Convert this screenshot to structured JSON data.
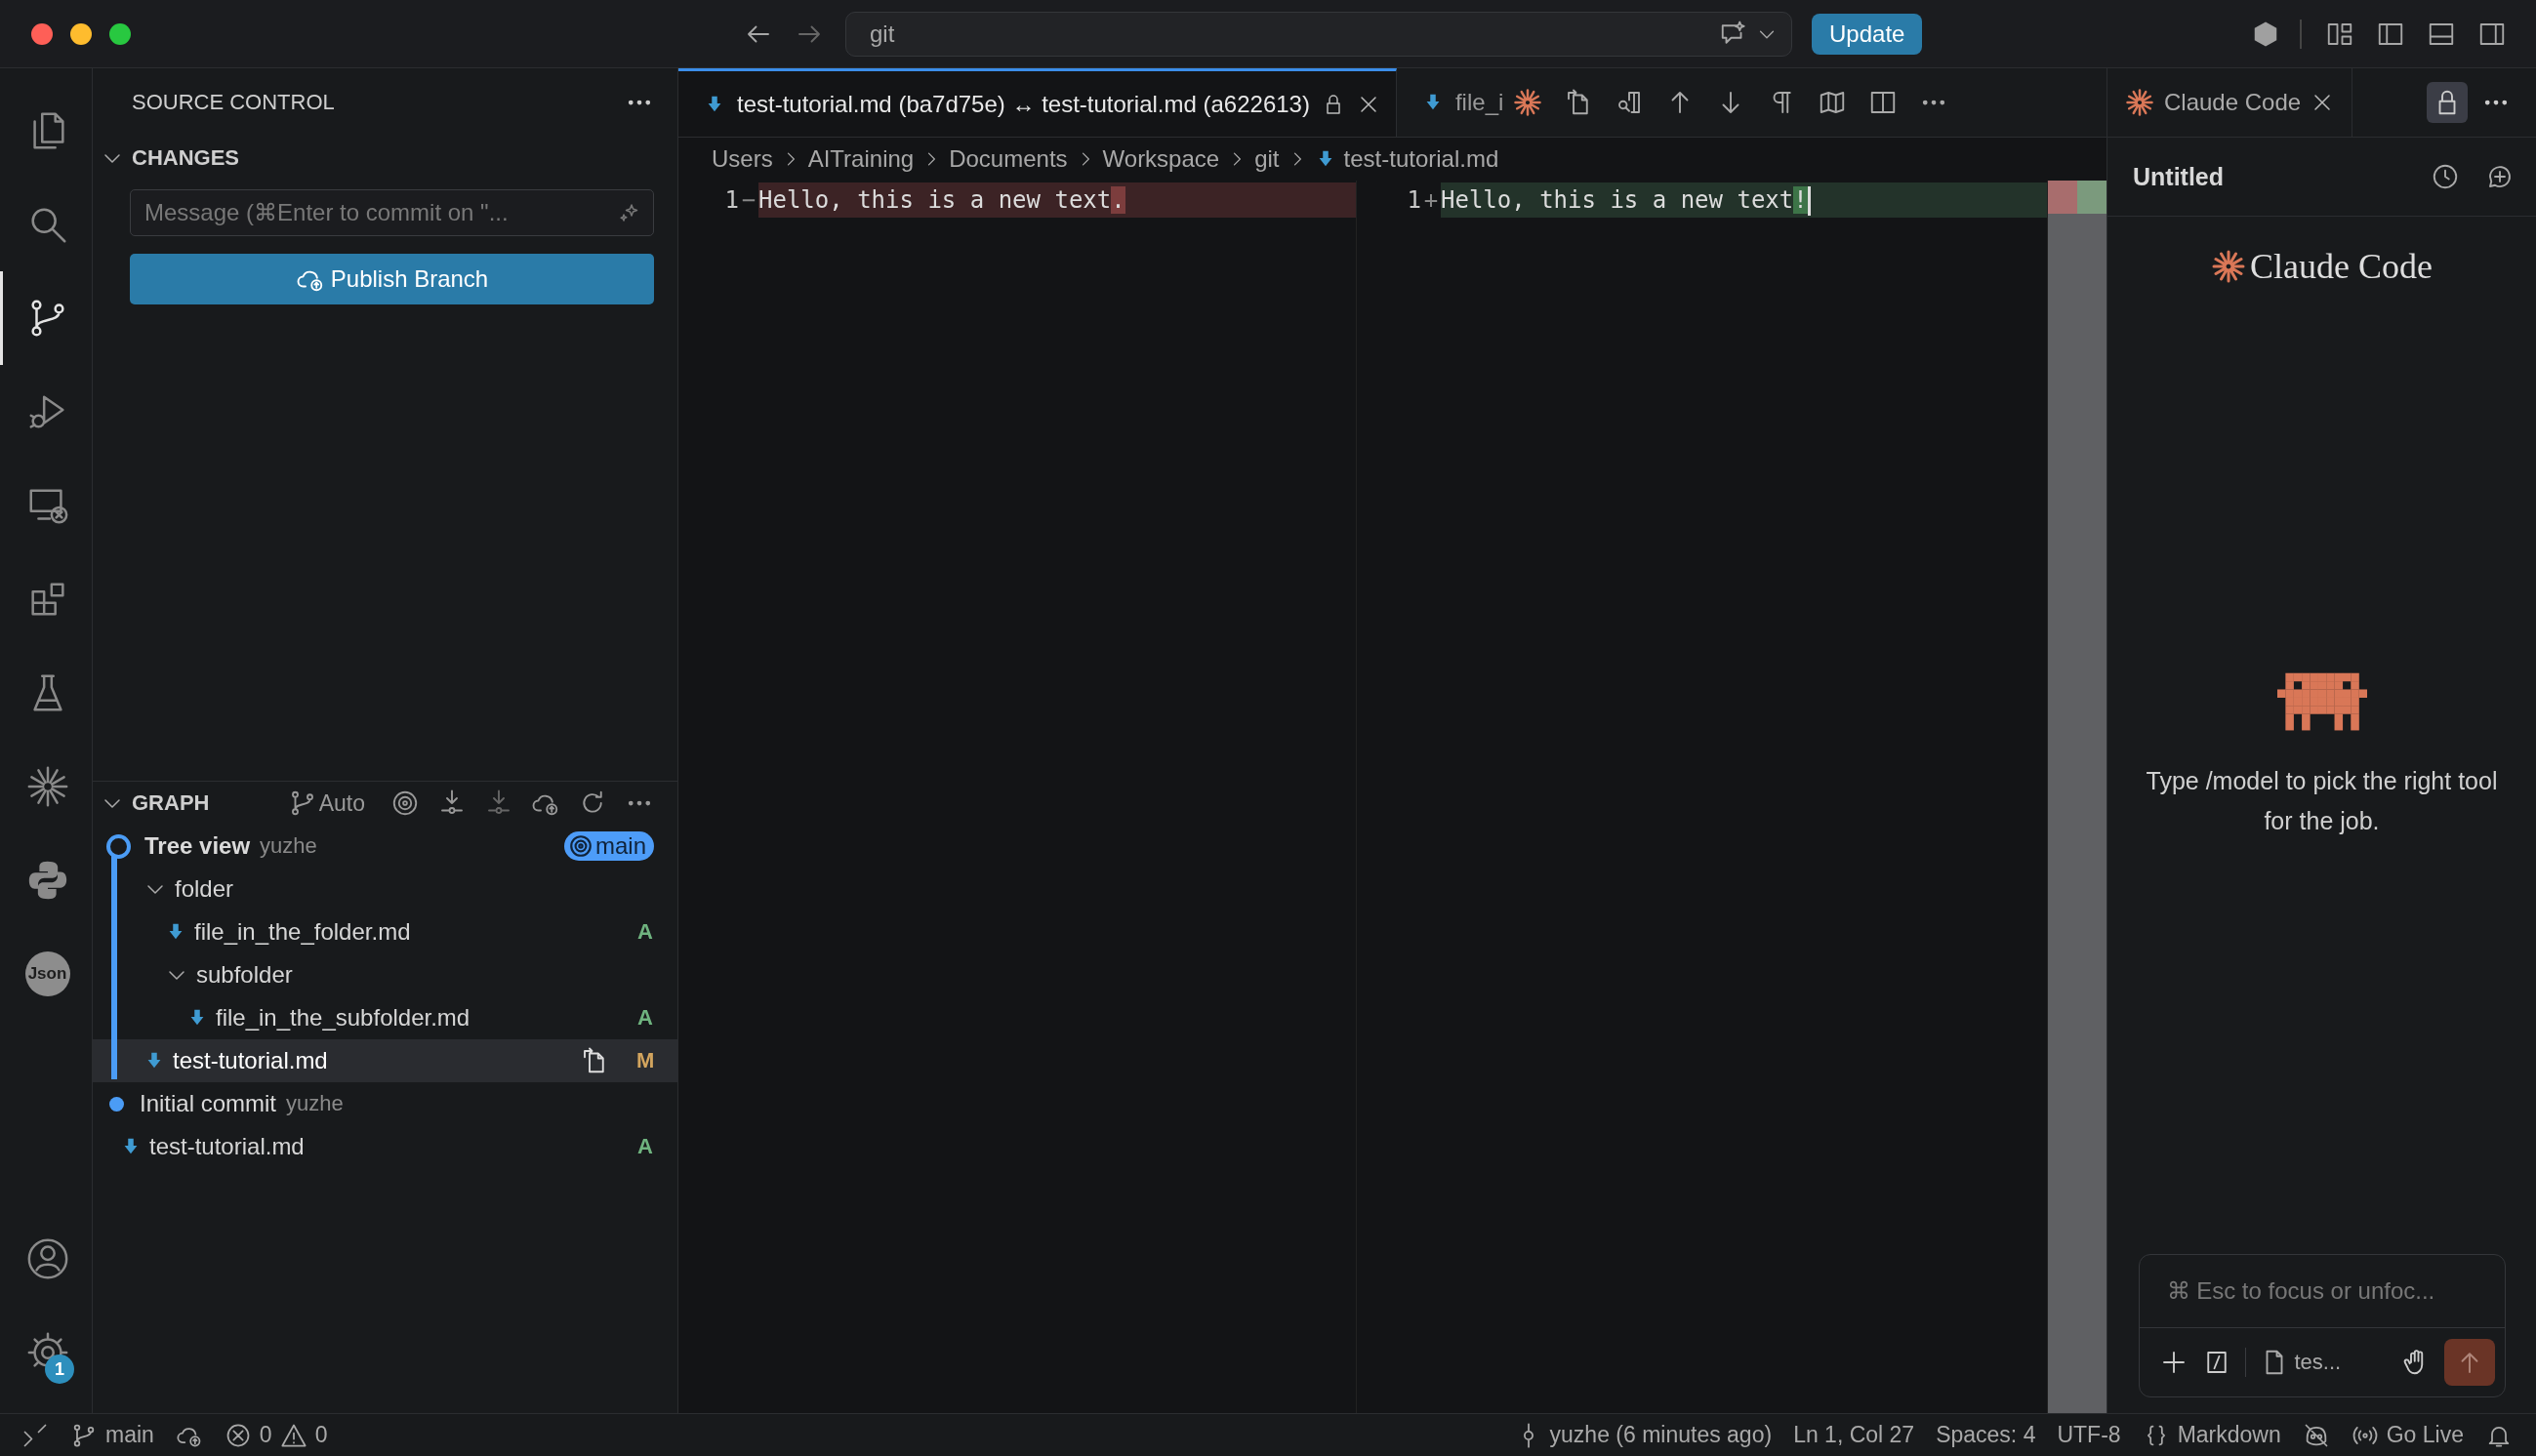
{
  "title_bar": {
    "search": "git",
    "update_button": "Update"
  },
  "activity_bar": {
    "items": [
      {
        "kind": "explorer",
        "selected": false
      },
      {
        "kind": "search",
        "selected": false
      },
      {
        "kind": "source-control",
        "selected": true
      },
      {
        "kind": "run-debug",
        "selected": false
      },
      {
        "kind": "remote",
        "selected": false
      },
      {
        "kind": "extensions",
        "selected": false
      },
      {
        "kind": "testing",
        "selected": false
      },
      {
        "kind": "claude",
        "selected": false
      },
      {
        "kind": "python",
        "selected": false
      },
      {
        "kind": "json",
        "label": "Json",
        "selected": false
      }
    ],
    "bottom": [
      {
        "kind": "account"
      },
      {
        "kind": "settings",
        "badge": "1"
      }
    ]
  },
  "sidebar": {
    "title": "SOURCE CONTROL",
    "changes": {
      "title": "CHANGES",
      "expanded": true,
      "message_placeholder": "Message (⌘Enter to commit on \"...",
      "publish_button": "Publish Branch"
    },
    "graph": {
      "title": "GRAPH",
      "expanded": true,
      "auto_label": "Auto",
      "commits": [
        {
          "title": "Tree view",
          "author": "yuzhe",
          "branch": "main",
          "head": true,
          "files": [
            {
              "kind": "folder",
              "name": "folder",
              "expanded": true,
              "selected": false,
              "children": [
                {
                  "kind": "file",
                  "name": "file_in_the_folder.md",
                  "status": "A",
                  "color": "#6fb37f",
                  "selected": false
                },
                {
                  "kind": "folder",
                  "name": "subfolder",
                  "expanded": true,
                  "selected": false,
                  "children": [
                    {
                      "kind": "file",
                      "name": "file_in_the_subfolder.md",
                      "status": "A",
                      "color": "#6fb37f",
                      "selected": false
                    }
                  ]
                }
              ]
            },
            {
              "kind": "file",
              "name": "test-tutorial.md",
              "status": "M",
              "color": "#d3a55e",
              "selected": true
            }
          ]
        },
        {
          "title": "Initial commit",
          "author": "yuzhe",
          "head": false,
          "files": [
            {
              "kind": "file",
              "name": "test-tutorial.md",
              "status": "A",
              "color": "#6fb37f",
              "selected": false
            }
          ]
        }
      ]
    }
  },
  "editor": {
    "tabs": [
      {
        "label": "test-tutorial.md (ba7d75e) ↔ test-tutorial.md (a622613)",
        "selected": true,
        "readonly": true
      },
      {
        "label": "file_i",
        "selected": false,
        "readonly": false
      }
    ],
    "breadcrumbs": [
      "Users",
      "AITraining",
      "Documents",
      "Workspace",
      "git",
      "test-tutorial.md"
    ],
    "diff": {
      "left": {
        "number": "1",
        "sign": "−",
        "text": "Hello, this is a new text",
        "change": "."
      },
      "right": {
        "number": "1",
        "sign": "+",
        "text": "Hello, this is a new text",
        "change": "!"
      }
    }
  },
  "claude_panel": {
    "tab": "Claude Code",
    "session_title": "Untitled",
    "logo_text": "Claude Code",
    "hint": "Type /model to pick the right tool for the job.",
    "input_placeholder": "⌘ Esc to focus or unfoc...",
    "attachment": "tes..."
  },
  "status_bar": {
    "branch": "main",
    "errors": "0",
    "warnings": "0",
    "blame": "yuzhe (6 minutes ago)",
    "cursor": "Ln 1, Col 27",
    "indent": "Spaces: 4",
    "encoding": "UTF-8",
    "language": "Markdown",
    "go_live": "Go Live"
  }
}
